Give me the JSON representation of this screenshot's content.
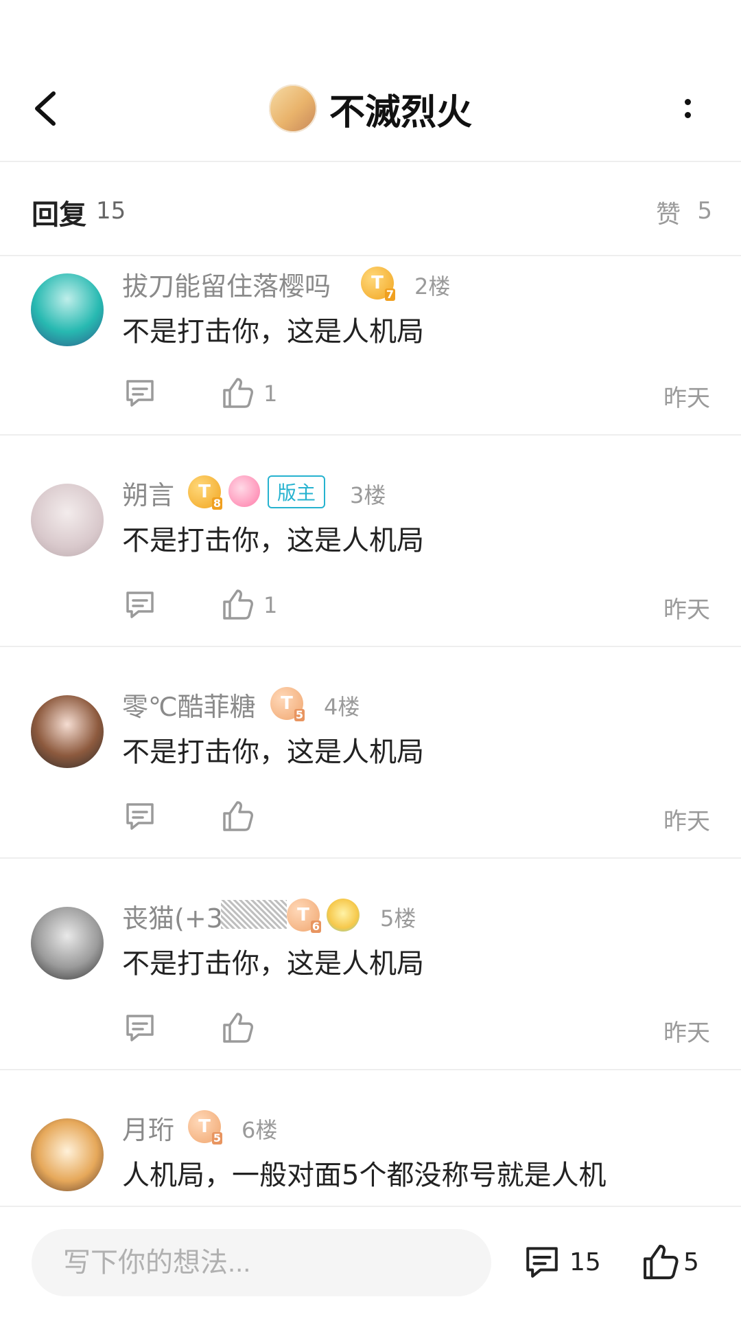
{
  "header": {
    "title": "不滅烈火"
  },
  "reply_bar": {
    "reply_label": "回复",
    "reply_count": "15",
    "like_label": "赞",
    "like_count": "5"
  },
  "comments": [
    {
      "username": "拔刀能留住落樱吗",
      "badge_level": "7",
      "floor": "2楼",
      "text": "不是打击你，这是人机局",
      "like_count": "1",
      "time": "昨天"
    },
    {
      "username": "朔言",
      "badge_level": "8",
      "mod_label": "版主",
      "floor": "3楼",
      "text": "不是打击你，这是人机局",
      "like_count": "1",
      "time": "昨天"
    },
    {
      "username": "零℃酷菲糖",
      "badge_level": "5",
      "floor": "4楼",
      "text": "不是打击你，这是人机局",
      "like_count": "",
      "time": "昨天"
    },
    {
      "username": "丧猫(+3",
      "badge_level": "6",
      "floor": "5楼",
      "text": "不是打击你，这是人机局",
      "like_count": "",
      "time": "昨天"
    },
    {
      "username": "月珩",
      "badge_level": "5",
      "floor": "6楼",
      "text": "人机局，一般对面5个都没称号就是人机"
    }
  ],
  "bottom_bar": {
    "input_placeholder": "写下你的想法...",
    "comment_count": "15",
    "like_count": "5"
  },
  "icons": {
    "back": "back-icon",
    "more": "more-icon",
    "comment": "comment-icon",
    "like": "thumbs-up-icon"
  },
  "colors": {
    "moderator": "#25b2cf",
    "badge_gold": "#f1a520",
    "badge_peach": "#f0a66f"
  }
}
